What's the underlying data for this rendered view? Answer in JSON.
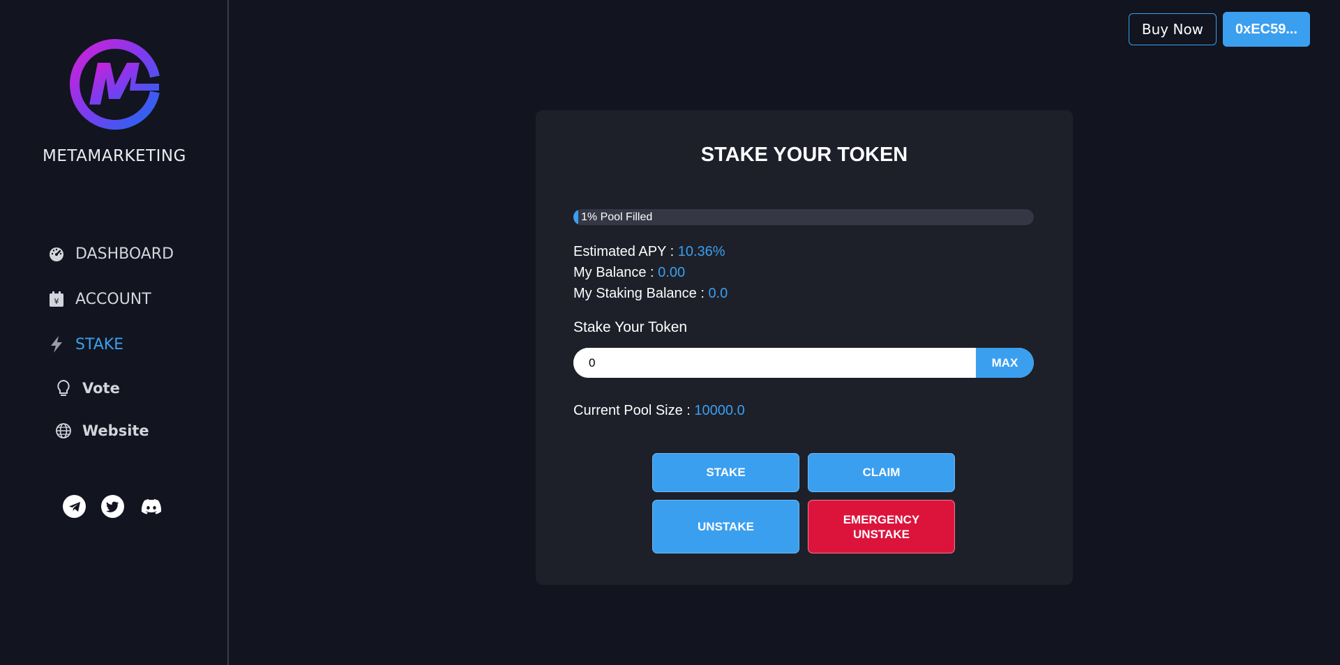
{
  "sidebar": {
    "brand": "METAMARKETING",
    "logo_letter": "M",
    "items": [
      {
        "label": "DASHBOARD",
        "icon": "speedometer-icon"
      },
      {
        "label": "ACCOUNT",
        "icon": "wallet-icon"
      },
      {
        "label": "STAKE",
        "icon": "lightning-icon",
        "active": true
      },
      {
        "label": "Vote",
        "icon": "lightbulb-icon"
      },
      {
        "label": "Website",
        "icon": "globe-icon"
      }
    ],
    "socials": [
      "telegram-icon",
      "twitter-icon",
      "discord-icon"
    ]
  },
  "header": {
    "buy_label": "Buy Now",
    "wallet_label": "0xEC59..."
  },
  "card": {
    "title": "STAKE YOUR TOKEN",
    "progress_text": "1% Pool Filled",
    "progress_percent": 1,
    "apy_label": "Estimated APY : ",
    "apy_value": "10.36%",
    "balance_label": "My Balance : ",
    "balance_value": "0.00",
    "staking_label": "My Staking Balance : ",
    "staking_value": "0.0",
    "stake_label": "Stake Your Token",
    "input_value": "0",
    "max_label": "MAX",
    "pool_label": "Current Pool Size : ",
    "pool_value": "10000.0",
    "buttons": {
      "stake": "STAKE",
      "claim": "CLAIM",
      "unstake": "UNSTAKE",
      "emergency_line1": "EMERGENCY",
      "emergency_line2": "UNSTAKE"
    }
  },
  "colors": {
    "accent": "#3b9ff0",
    "danger": "#dc143c",
    "background": "#12141f",
    "card": "#1d2029"
  }
}
